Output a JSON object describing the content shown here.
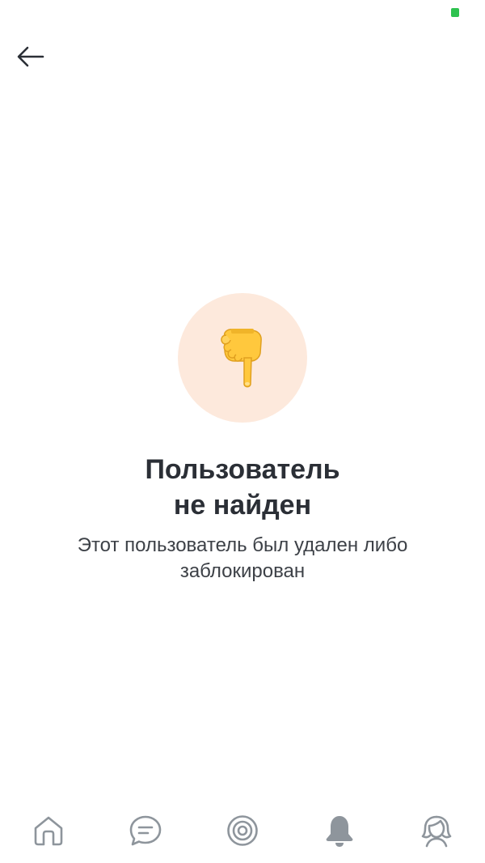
{
  "status_bar": {
    "battery_color": "#2ec24f"
  },
  "header": {
    "back_icon": "arrow-left-icon"
  },
  "empty_state": {
    "emoji": "👇",
    "emoji_icon": "backhand-index-pointing-down-icon",
    "circle_color": "#fde9dc",
    "title_line1": "Пользователь",
    "title_line2": "не найден",
    "subtitle_line1": "Этот пользователь был удален либо",
    "subtitle_line2": "заблокирован"
  },
  "tab_bar": {
    "icon_color": "#8e959c",
    "active_index": 3,
    "tabs": [
      {
        "icon": "home-icon"
      },
      {
        "icon": "chat-icon"
      },
      {
        "icon": "target-icon"
      },
      {
        "icon": "bell-icon"
      },
      {
        "icon": "profile-icon"
      }
    ]
  }
}
